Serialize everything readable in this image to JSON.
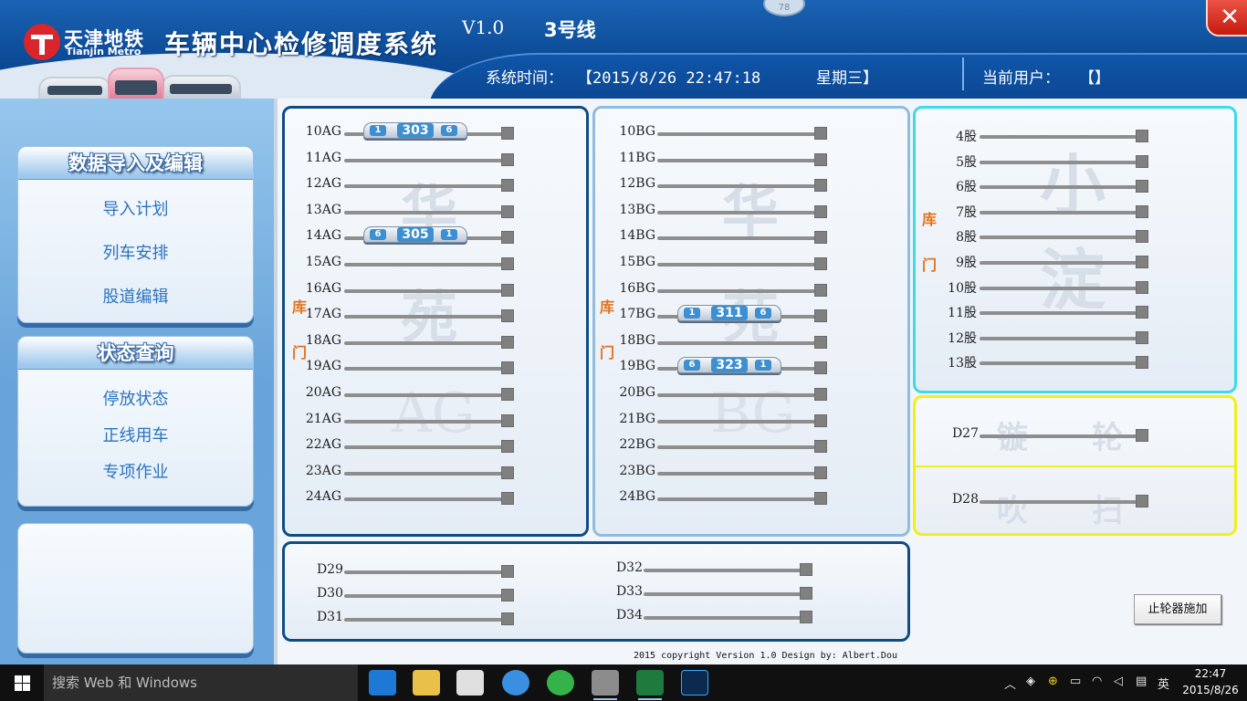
{
  "header": {
    "logo_cn": "天津地铁",
    "logo_en": "Tianjin Metro",
    "app_title": "车辆中心检修调度系统",
    "version": "V1.0",
    "line": "3号线",
    "sys_time_label": "系统时间：",
    "sys_time_value": "【2015/8/26 22:47:18",
    "weekday": "星期三】",
    "user_label": "当前用户：",
    "user_value": "【】",
    "badge": "78",
    "close_glyph": "✕"
  },
  "sidebar": {
    "import_title": "数据导入及编辑",
    "import_items": [
      "导入计划",
      "列车安排",
      "股道编辑"
    ],
    "status_title": "状态查询",
    "status_items": [
      "停放状态",
      "正线用车",
      "专项作业"
    ]
  },
  "yards": {
    "ag": {
      "watermark": [
        "华",
        "苑"
      ],
      "watermark_latin": "AG",
      "door": [
        "库",
        "门"
      ],
      "tracks": [
        "10AG",
        "11AG",
        "12AG",
        "13AG",
        "14AG",
        "15AG",
        "16AG",
        "17AG",
        "18AG",
        "19AG",
        "20AG",
        "21AG",
        "22AG",
        "23AG",
        "24AG"
      ]
    },
    "bg": {
      "watermark": [
        "华",
        "苑"
      ],
      "watermark_latin": "BG",
      "door": [
        "库",
        "门"
      ],
      "tracks": [
        "10BG",
        "11BG",
        "12BG",
        "13BG",
        "14BG",
        "15BG",
        "16BG",
        "17BG",
        "18BG",
        "19BG",
        "20BG",
        "21BG",
        "22BG",
        "23BG",
        "24BG"
      ]
    },
    "xd": {
      "watermark": [
        "小",
        "淀"
      ],
      "door": [
        "库",
        "门"
      ],
      "tracks": [
        "4股",
        "5股",
        "6股",
        "7股",
        "8股",
        "9股",
        "10股",
        "11股",
        "12股",
        "13股"
      ]
    },
    "wheel": {
      "tracks": [
        "D27",
        "D28"
      ],
      "watermark_top": [
        "镟",
        "轮"
      ],
      "watermark_bottom": [
        "吹",
        "扫"
      ]
    },
    "d": {
      "tracks": [
        "D29",
        "D30",
        "D31",
        "D32",
        "D33",
        "D34"
      ]
    }
  },
  "trains": [
    {
      "track": "10AG",
      "number": "303",
      "left_end": "1",
      "right_end": "6"
    },
    {
      "track": "14AG",
      "number": "305",
      "left_end": "6",
      "right_end": "1"
    },
    {
      "track": "17BG",
      "number": "311",
      "left_end": "1",
      "right_end": "6"
    },
    {
      "track": "19BG",
      "number": "323",
      "left_end": "6",
      "right_end": "1"
    }
  ],
  "controls": {
    "stop_button": "止轮器施加"
  },
  "footer": {
    "copyright": "2015 copyright  Version 1.0  Design by: Albert.Dou"
  },
  "taskbar": {
    "search_placeholder": "搜索 Web 和 Windows",
    "ime": "英",
    "time": "22:47",
    "date": "2015/8/26",
    "apps": [
      "edge-icon",
      "file-explorer-icon",
      "store-icon",
      "sogou-icon",
      "browser-icon",
      "app-icon",
      "excel-icon",
      "photoshop-icon"
    ]
  },
  "colors": {
    "header_blue": "#0d4c98",
    "ag_border": "#0e4c83",
    "bg_border": "#90bcdf",
    "xd_border": "#3edbe6",
    "wheel_border": "#f0f019",
    "door_text": "#e07320",
    "sidebar_link": "#2c73bf",
    "train_badge": "#3c8fd0"
  }
}
